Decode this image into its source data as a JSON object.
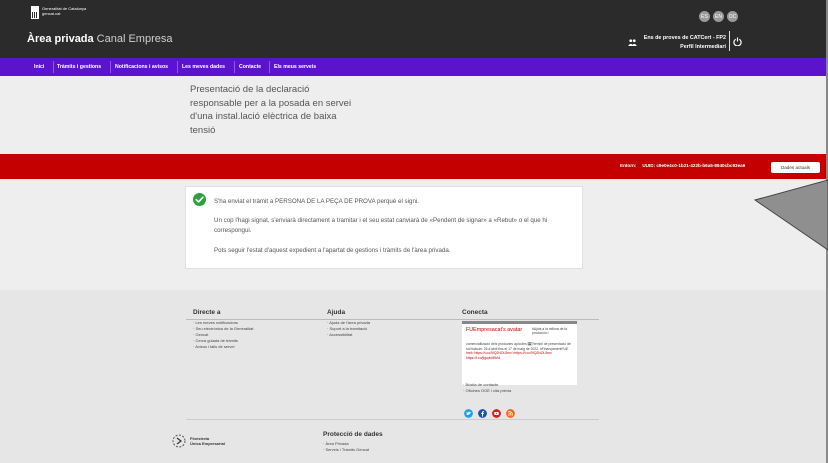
{
  "header": {
    "gov_logo_line1": "Generalitat de Catalunya",
    "gov_logo_line2": "gencat.cat",
    "title": "Àrea privada",
    "subtitle": "Canal Empresa",
    "languages": [
      "ES",
      "EN",
      "OC"
    ],
    "user_org": "Ens de proves de CATCert - FP2",
    "user_profile": "Perfil Intermediari"
  },
  "nav": {
    "items": [
      "Inici",
      "Tràmits i gestions",
      "Notificacions i avisos",
      "Les meves dades",
      "Contacte",
      "Els meus serveis"
    ]
  },
  "page": {
    "title": "Presentació de la declaració responsable per a la posada en servei d'una instal.lació elèctrica de baixa tensió"
  },
  "band": {
    "env_label": "Entorn:",
    "uuid": "UUID: c9e0e4c0-1b21-422b-b6a5-8940cbc93ea6",
    "button": "Dades actuals"
  },
  "message": {
    "line1": "S'ha enviat el tràmit a PERSONA DE LA PEÇA DE PROVA perquè el signi.",
    "line2": "Un cop l'hagi signat, s'enviarà directament a tramitar i el seu estat canviarà de «Pendent de signar» a «Rebut» o el que hi correspongui.",
    "line3": "Pots seguir l'estat d'aquest expedient a l'apartat de gestions i tràmits de l'àrea privada."
  },
  "footer": {
    "directe": {
      "title": "Directe a",
      "links": [
        "Les meves notificacions",
        "Seu electrònica de la Generalitat",
        "Gencat",
        "Cerca guiada de tràmits",
        "Avisos i talls de servei"
      ]
    },
    "ajuda": {
      "title": "Ajuda",
      "links": [
        "Ajuda de l'àrea privada",
        "Suport a la tramitació",
        "Accessibilitat"
      ]
    },
    "conecta": {
      "title": "Conecta",
      "tweet_head": "FUEmpresacat's avatar",
      "tweet_right": "#Ajuts a la millora de la producció i",
      "tweet_body": "comercialització dels productes apícoles 🗓Termini de presentació de sol·licituds: 26 d'abril fins el 17 de maig de 2022. #FinançamentFUE",
      "tweet_link": "href='https://t.co/9IQ2NOL5mv'>https://t.co/9IQ2NOL5mv https://t.co/jlgcpbM9A4",
      "links": [
        "Bústia de contacte",
        "Oficines OGE i cita prèvia"
      ]
    },
    "proteccio": {
      "title": "Protecció de dades",
      "links": [
        "Àrea Privada",
        "Serveis i Tràmits Gencat"
      ]
    },
    "finestreta": {
      "line1": "Finestreta",
      "line2": "Única Empresarial"
    }
  },
  "colors": {
    "header_bg": "#2b2b2b",
    "nav_bg": "#5b13cc",
    "band_bg": "#c40000",
    "success": "#2e9f3d"
  }
}
